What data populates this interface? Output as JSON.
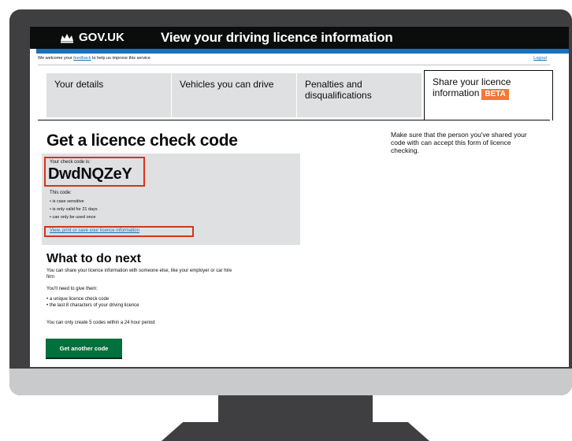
{
  "header": {
    "logo_text": "GOV.UK",
    "service_title": "View your driving licence information"
  },
  "feedback_bar": {
    "prefix": "We welcome your ",
    "link_label": "feedback",
    "suffix": " to help us improve this service",
    "logout_label": "Logout"
  },
  "tabs": [
    {
      "label": "Your details"
    },
    {
      "label": "Vehicles you can drive"
    },
    {
      "label": "Penalties and disqualifications"
    },
    {
      "label": "Share your licence information",
      "badge": "BETA"
    }
  ],
  "main": {
    "heading": "Get a licence check code",
    "sidebar_note": "Make sure that the person you've shared your code with can accept this form of licence checking.",
    "code_panel": {
      "label": "Your check code is:",
      "code": "DwdNQZeY",
      "intro": "This code:",
      "rules": [
        "is case sensitive",
        "is only valid for 21 days",
        "can only be used once"
      ],
      "view_link": "View, print or save your licence information"
    },
    "next": {
      "heading": "What to do next",
      "intro": "You can share your licence information with someone else, like your employer or car hire firm",
      "need": "You'll need to give them:",
      "items": [
        "a unique licence check code",
        "the last 8 characters of your driving licence"
      ],
      "limit": "You can only create 5 codes within a 24 hour period",
      "button_label": "Get another code"
    }
  },
  "colors": {
    "header_bg": "#0b0c0c",
    "accent_blue": "#1d70b8",
    "beta_badge": "#f47738",
    "highlight_red": "#d4351c",
    "button_green": "#00703c",
    "monitor_frame": "#3f3f41"
  }
}
